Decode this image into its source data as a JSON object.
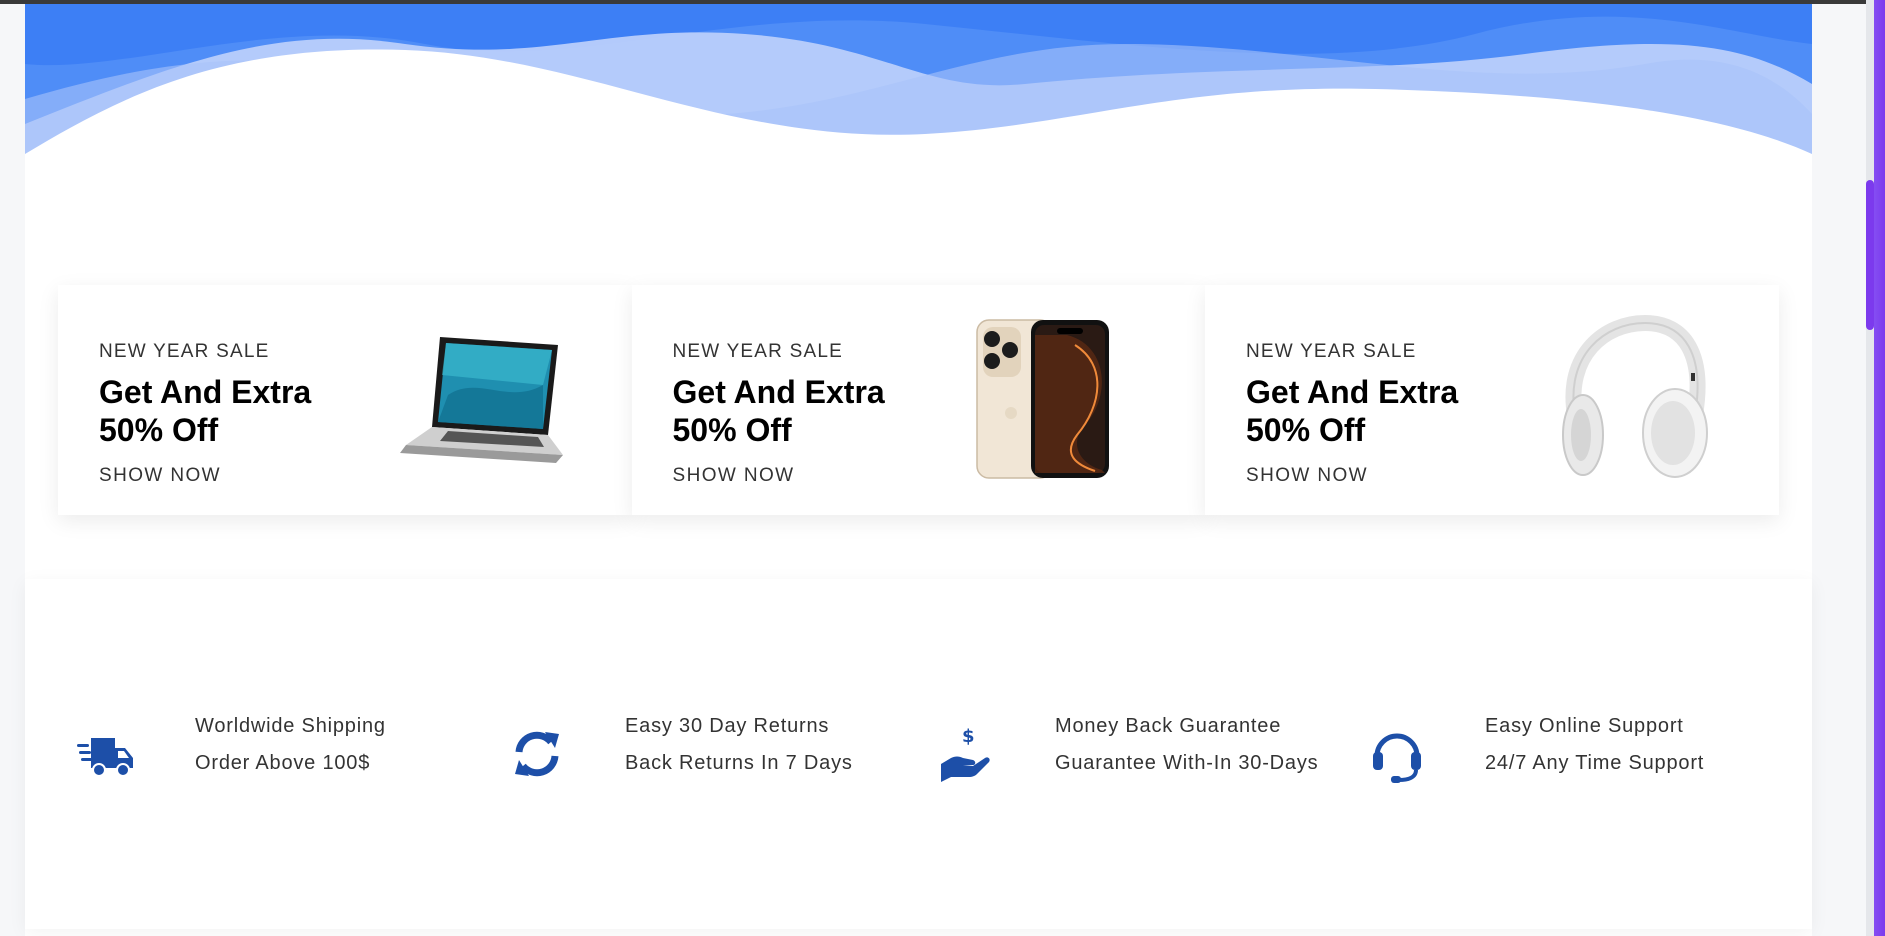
{
  "colors": {
    "wave_dark": "#3b82f6",
    "wave_light": "#bcd0fb",
    "icon_blue": "#1d4fa8",
    "scrollbar": "#8b5cf6"
  },
  "promos": [
    {
      "eyebrow": "NEW YEAR SALE",
      "title": "Get And Extra 50% Off",
      "cta": "SHOW NOW",
      "image": "laptop-image"
    },
    {
      "eyebrow": "NEW YEAR SALE",
      "title": "Get And Extra 50% Off",
      "cta": "SHOW NOW",
      "image": "phone-image"
    },
    {
      "eyebrow": "NEW YEAR SALE",
      "title": "Get And Extra 50% Off",
      "cta": "SHOW NOW",
      "image": "headphones-image"
    }
  ],
  "features": [
    {
      "icon": "truck-icon",
      "title": "Worldwide Shipping",
      "subtitle": "Order Above 100$"
    },
    {
      "icon": "refresh-icon",
      "title": "Easy 30 Day Returns",
      "subtitle": "Back Returns In 7 Days"
    },
    {
      "icon": "hand-money-icon",
      "title": "Money Back Guarantee",
      "subtitle": "Guarantee With-In 30-Days"
    },
    {
      "icon": "headset-icon",
      "title": "Easy Online Support",
      "subtitle": "24/7 Any Time Support"
    }
  ]
}
